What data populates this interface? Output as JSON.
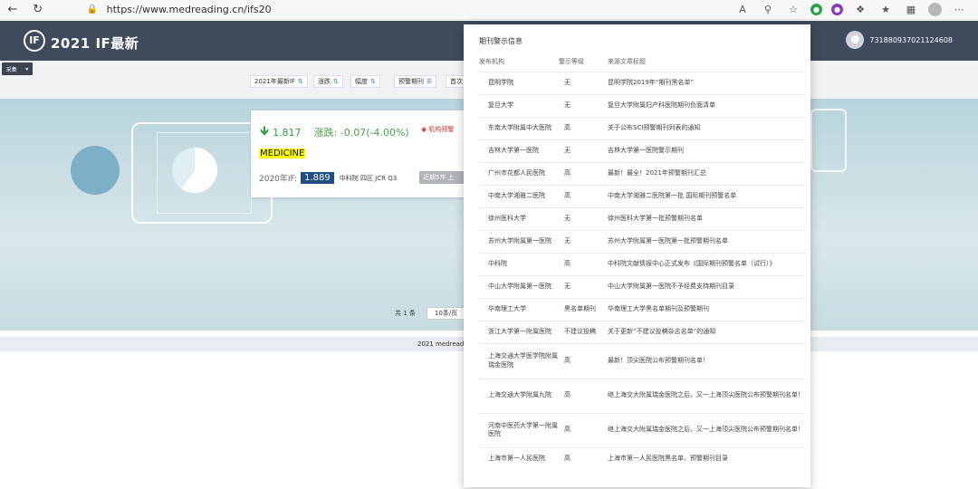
{
  "browser": {
    "url": "https://www.medreading.cn/ifs20",
    "reader_icon": "A",
    "zoom_icon": "search-icon"
  },
  "header": {
    "logo_mark": "IF",
    "logo_text": "2021 IF最新",
    "username": "731880937021124608"
  },
  "toolbar": {
    "select_label": "采集",
    "filters": [
      "2021年最新IF",
      "涨跌",
      "幅度",
      "预警期刊",
      "首次"
    ]
  },
  "card": {
    "if_value": "1.817",
    "change": "涨跌: -0.07(-4.00%)",
    "warning": "机构预警",
    "journal": "MEDICINE",
    "prev_label": "2020年IF:",
    "prev_value": "1.889",
    "meta": "中科院  四区  JCR  Q3",
    "tag": "近期5年  上"
  },
  "pager": {
    "total": "共 1 条",
    "per_page": "10条/页"
  },
  "footer": {
    "text": "2021 medread"
  },
  "popup": {
    "title": "期刊警示信息",
    "columns": [
      "发布机构",
      "警示等级",
      "来源文章标题"
    ],
    "rows": [
      {
        "org": "昆明学院",
        "level": "无",
        "title": "昆明学院2019年“期刊黑名单”"
      },
      {
        "org": "复旦大学",
        "level": "无",
        "title": "复旦大学附属妇产科医院期刊负面清单"
      },
      {
        "org": "东南大学附属中大医院",
        "level": "高",
        "title": "关于公布SCI预警期刊列表的通知"
      },
      {
        "org": "吉林大学第一医院",
        "level": "无",
        "title": "吉林大学第一医院警示期刊"
      },
      {
        "org": "广州市花都人民医院",
        "level": "高",
        "title": "最新！最全！2021年预警期刊汇总"
      },
      {
        "org": "中南大学湘雅二医院",
        "level": "高",
        "title": "中南大学湘雅二医院第一批 国际期刊预警名单"
      },
      {
        "org": "徐州医科大学",
        "level": "无",
        "title": "徐州医科大学第一批预警期刊名单"
      },
      {
        "org": "苏州大学附属第一医院",
        "level": "无",
        "title": "苏州大学附属第一医院第一批预警期刊名单"
      },
      {
        "org": "中科院",
        "level": "高",
        "title": "中科院文献情报中心正式发布《国际期刊预警名单（试行）》"
      },
      {
        "org": "中山大学附属第一医院",
        "level": "无",
        "title": "中山大学附属第一医院不予经费支持期刊目录"
      },
      {
        "org": "华南理工大学",
        "level": "黑名单期刊",
        "title": "华南理工大学黑名单期刊及预警期刊"
      },
      {
        "org": "浙江大学第一附属医院",
        "level": "不建议投稿",
        "title": "关于更新“不建议投稿杂志名单”的通知"
      },
      {
        "org": "上海交通大学医学院附属瑞金医院",
        "level": "高",
        "title": "最新！顶尖医院公布预警期刊名单！"
      },
      {
        "org": "上海交通大学附属九院",
        "level": "高",
        "title": "继上海交大附属瑞金医院之后，又一上海顶尖医院公布预警期刊名单！"
      },
      {
        "org": "河南中医药大学第一附属医院",
        "level": "高",
        "title": "继上海交大附属瑞金医院之后，又一上海顶尖医院公布预警期刊名单！"
      },
      {
        "org": "上海市第一人民医院",
        "level": "高",
        "title": "上海市第一人民医院黑名单、预警期刊目录"
      }
    ]
  }
}
